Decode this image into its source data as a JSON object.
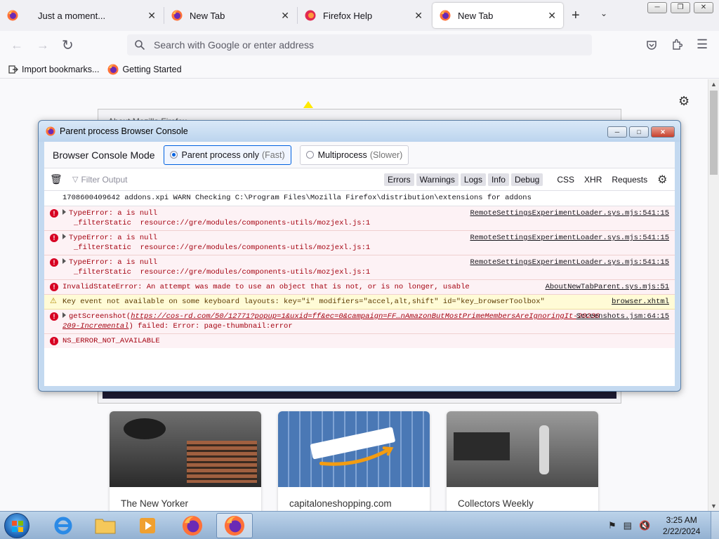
{
  "tabs": [
    {
      "label": "Just a moment..."
    },
    {
      "label": "New Tab"
    },
    {
      "label": "Firefox Help"
    },
    {
      "label": "New Tab"
    }
  ],
  "tab_close_glyph": "✕",
  "urlbar": {
    "placeholder": "Search with Google or enter address"
  },
  "bookmarks": [
    {
      "label": "Import bookmarks..."
    },
    {
      "label": "Getting Started"
    }
  ],
  "top_sites": [
    {
      "title": "The New Yorker"
    },
    {
      "title": "capitaloneshopping.com"
    },
    {
      "title": "Collectors Weekly"
    }
  ],
  "behind_dialog": {
    "title": "About Mozilla Firefox"
  },
  "console": {
    "title": "Parent process Browser Console",
    "mode_label": "Browser Console Mode",
    "mode_parent": "Parent process only",
    "mode_parent_hint": "(Fast)",
    "mode_multi": "Multiprocess",
    "mode_multi_hint": "(Slower)",
    "filter_placeholder": "Filter Output",
    "levels": [
      "Errors",
      "Warnings",
      "Logs",
      "Info",
      "Debug"
    ],
    "categories": [
      "CSS",
      "XHR",
      "Requests"
    ],
    "messages": [
      {
        "type": "plain",
        "text": "1708600409642   addons.xpi      WARN    Checking C:\\Program Files\\Mozilla Firefox\\distribution\\extensions for addons"
      },
      {
        "type": "err",
        "text": "TypeError: a is null",
        "sub": "_filterStatic",
        "path": "resource://gre/modules/components-utils/mozjexl.js:1",
        "src": "RemoteSettingsExperimentLoader.sys.mjs:541:15"
      },
      {
        "type": "err",
        "text": "TypeError: a is null",
        "sub": "_filterStatic",
        "path": "resource://gre/modules/components-utils/mozjexl.js:1",
        "src": "RemoteSettingsExperimentLoader.sys.mjs:541:15"
      },
      {
        "type": "err",
        "text": "TypeError: a is null",
        "sub": "_filterStatic",
        "path": "resource://gre/modules/components-utils/mozjexl.js:1",
        "src": "RemoteSettingsExperimentLoader.sys.mjs:541:15"
      },
      {
        "type": "err",
        "text": "InvalidStateError: An attempt was made to use an object that is not, or is no longer, usable",
        "src": "AboutNewTabParent.sys.mjs:51"
      },
      {
        "type": "warn",
        "text": "Key event not available on some keyboard layouts: key=\"i\" modifiers=\"accel,alt,shift\" id=\"key_browserToolbox\"",
        "src": "browser.xhtml"
      },
      {
        "type": "err",
        "text_pre": "getScreenshot(",
        "link": "https://cos-rd.com/50/12771?popup=1&uxid=ff&ec=0&campaign=FF…nAmazonButMostPrimeMembersAreIgnoringIt-20230209-Incremental",
        "link_line1": "https://cos-rd.com/50/12771?popup=1&uxid=ff&ec=0&campaign=FF…nAmazonButMostPrimeMembersAreIgnoringIt-20230",
        "link_line2": "209-Incremental",
        "text_post": ") failed: Error: page-thumbnail:error",
        "src": "Screenshots.jsm:64:15"
      },
      {
        "type": "err",
        "text": "NS_ERROR_NOT_AVAILABLE"
      }
    ]
  },
  "clock": {
    "time": "3:25 AM",
    "date": "2/22/2024"
  },
  "colors": {
    "accent": "#0061e0",
    "error": "#a4000f",
    "error_bg": "#fdf2f5",
    "warn_bg": "#fffbd6"
  }
}
